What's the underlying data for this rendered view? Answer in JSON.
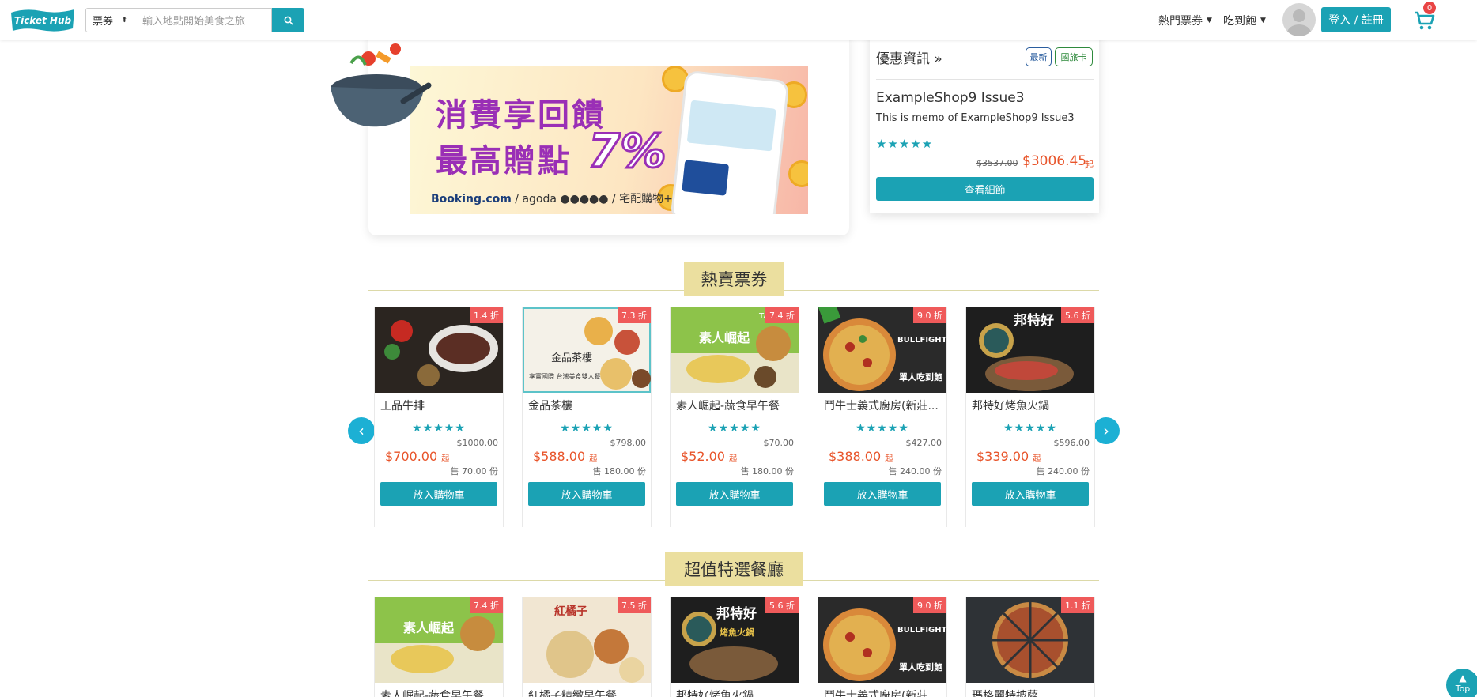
{
  "navbar": {
    "logo_text": "Ticket Hub",
    "search_category": "票券",
    "search_placeholder": "輸入地點開始美食之旅",
    "menu_hot": "熱門票券",
    "menu_buffet": "吃到飽",
    "login_label": "登入 / 註冊",
    "cart_count": "0"
  },
  "banner": {
    "line1": "消費享回饋",
    "line2": "最高贈點",
    "percent": "7%",
    "footer_booking": "Booking.com",
    "footer_rest": " / agoda ●●●●● / 宅配購物+"
  },
  "promo": {
    "title": "優惠資訊 »",
    "tag_new": "最新",
    "tag_card": "國旅卡",
    "shop": "ExampleShop9 Issue3",
    "memo": "This is memo of ExampleShop9 Issue3",
    "stars": "★★★★★",
    "old_price": "$3537.00",
    "new_price": "$3006.45",
    "suffix": "起",
    "button": "查看細節"
  },
  "sections": {
    "hot_title": "熱賣票券",
    "value_title": "超值特選餐廳"
  },
  "hot_items": [
    {
      "name": "王品牛排",
      "discount": "1.4 折",
      "stars": "★★★★★",
      "old": "$1000.00",
      "price": "$700.00",
      "suffix": "起",
      "sold": "售 70.00 份",
      "button": "放入購物車"
    },
    {
      "name": "金品茶樓",
      "discount": "7.3 折",
      "stars": "★★★★★",
      "old": "$798.00",
      "price": "$588.00",
      "suffix": "起",
      "sold": "售 180.00 份",
      "button": "放入購物車"
    },
    {
      "name": "素人崛起-蔬食早午餐",
      "discount": "7.4 折",
      "stars": "★★★★★",
      "old": "$70.00",
      "price": "$52.00",
      "suffix": "起",
      "sold": "售 180.00 份",
      "button": "放入購物車"
    },
    {
      "name": "鬥牛士義式廚房(新莊...",
      "discount": "9.0 折",
      "stars": "★★★★★",
      "old": "$427.00",
      "price": "$388.00",
      "suffix": "起",
      "sold": "售 240.00 份",
      "button": "放入購物車"
    },
    {
      "name": "邦特好烤魚火鍋",
      "discount": "5.6 折",
      "stars": "★★★★★",
      "old": "$596.00",
      "price": "$339.00",
      "suffix": "起",
      "sold": "售 240.00 份",
      "button": "放入購物車"
    }
  ],
  "value_items": [
    {
      "name": "素人崛起-蔬食早午餐",
      "discount": "7.4 折"
    },
    {
      "name": "紅橘子精緻早午餐",
      "discount": "7.5 折"
    },
    {
      "name": "邦特好烤魚火鍋",
      "discount": "5.6 折"
    },
    {
      "name": "鬥牛士義式廚房(新莊...",
      "discount": "9.0 折"
    },
    {
      "name": "瑪格麗特披薩",
      "discount": "1.1 折"
    }
  ],
  "image_texts": {
    "jinpin": "金品茶樓",
    "jinpin_sub": "享實國際 台灣美食雙人餐",
    "suren": "素人崛起",
    "take": "TAKE",
    "bullfight": "BULLFIGHT",
    "bullfight_sub": "單人吃到飽",
    "bangte": "邦特好",
    "bangte_sub": "烤魚火鍋",
    "hongjuzi": "紅橘子"
  },
  "controls": {
    "prev": "‹",
    "next": "›",
    "top_label": "Top"
  },
  "colors": {
    "accent": "#1ba2b4",
    "price": "#e8542a",
    "discount_badge": "#ef5a5a",
    "section_heading_bg": "#ebdf9f"
  }
}
